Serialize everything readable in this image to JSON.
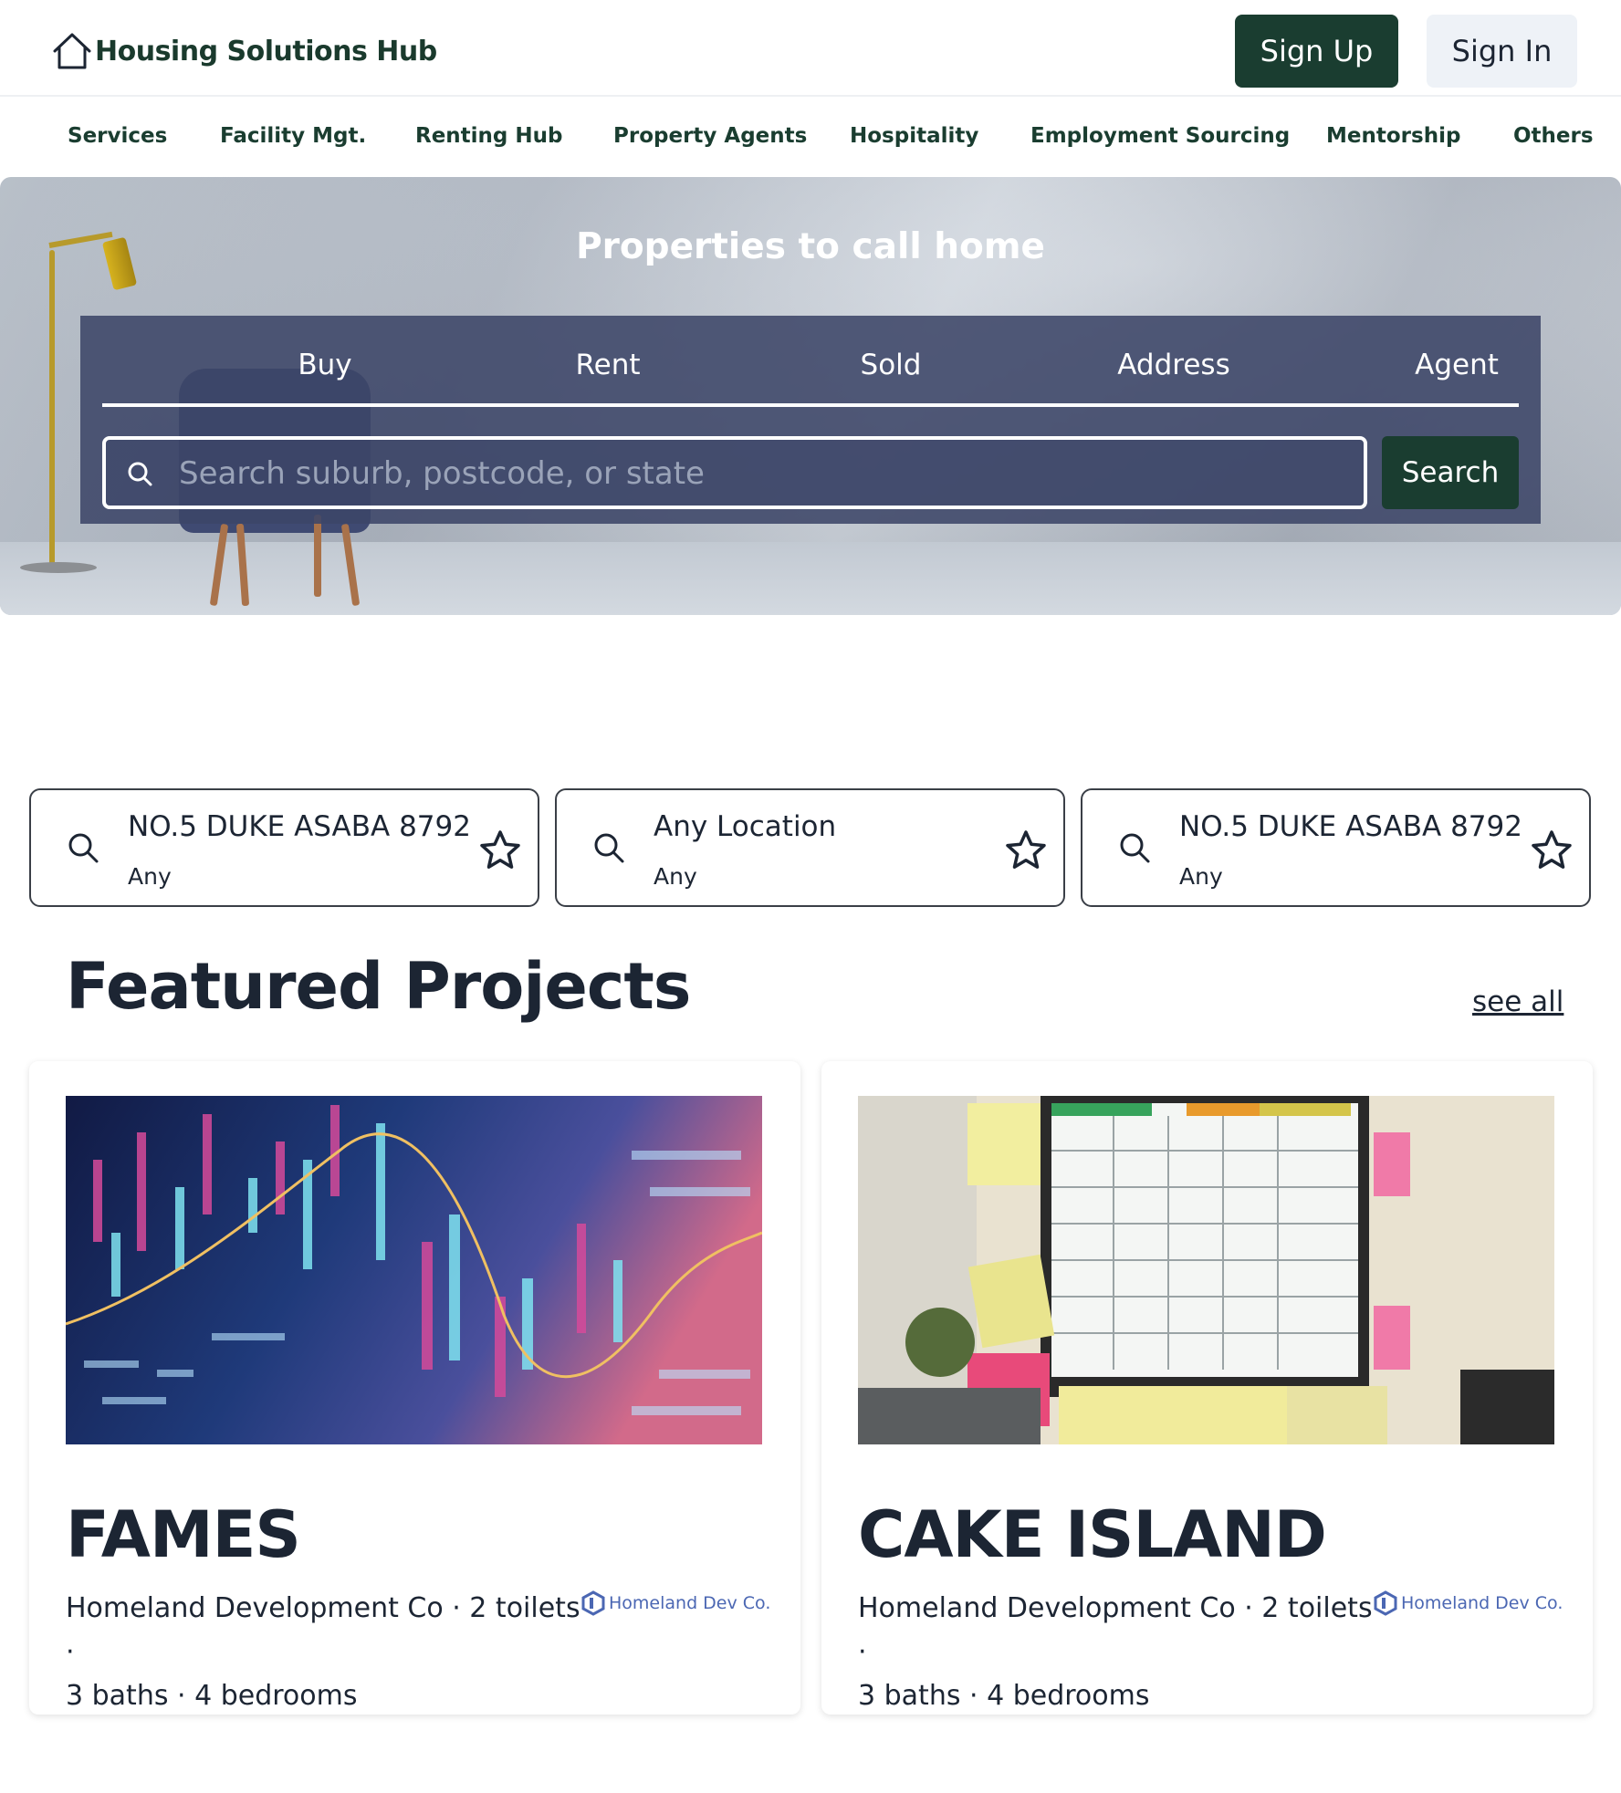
{
  "header": {
    "brand": "Housing Solutions Hub",
    "sign_up": "Sign Up",
    "sign_in": "Sign In"
  },
  "nav": {
    "items": [
      "Services",
      "Facility Mgt.",
      "Renting Hub",
      "Property Agents",
      "Hospitality",
      "Employment Sourcing",
      "Mentorship",
      "Others"
    ]
  },
  "hero": {
    "title": "Properties to call home",
    "tabs": [
      "Buy",
      "Rent",
      "Sold",
      "Address",
      "Agent"
    ],
    "search_placeholder": "Search suburb, postcode, or state",
    "search_button": "Search"
  },
  "saved_searches": [
    {
      "title": "NO.5 DUKE ASABA 8792",
      "subtitle": "Any"
    },
    {
      "title": "Any Location",
      "subtitle": "Any"
    },
    {
      "title": "NO.5 DUKE ASABA 8792",
      "subtitle": "Any"
    }
  ],
  "featured": {
    "title": "Featured Projects",
    "see_all": "see all",
    "projects": [
      {
        "name": "FAMES",
        "meta_line1": "Homeland Development Co · 2 toilets ·",
        "meta_line2": "3 baths · 4 bedrooms",
        "logo_text": "Homeland Dev Co."
      },
      {
        "name": "CAKE ISLAND",
        "meta_line1": "Homeland Development Co · 2 toilets ·",
        "meta_line2": "3 baths · 4 bedrooms",
        "logo_text": "Homeland Dev Co."
      }
    ]
  },
  "colors": {
    "brand_green": "#1a3d30",
    "panel": "#3c4568",
    "text": "#1c2533",
    "logo_blue": "#4b67b3"
  }
}
